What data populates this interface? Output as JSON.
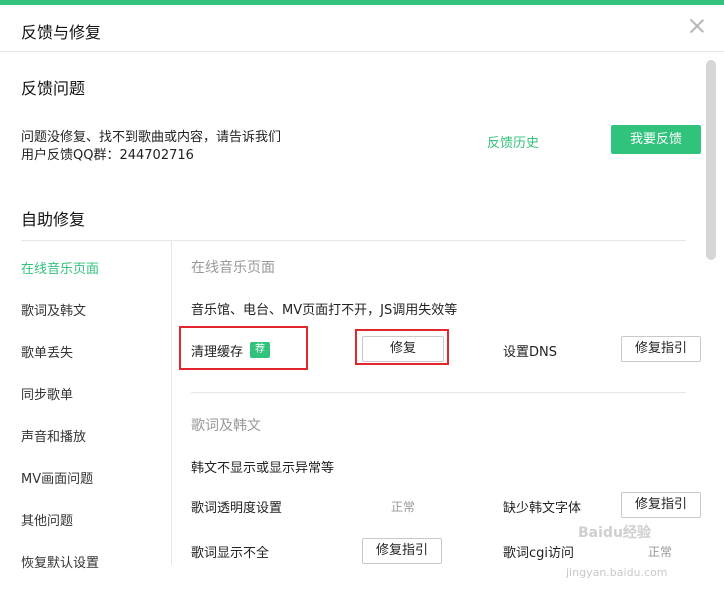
{
  "dialog": {
    "title": "反馈与修复"
  },
  "feedback": {
    "section_title": "反馈问题",
    "line1": "问题没修复、找不到歌曲或内容，请告诉我们",
    "line2": "用户反馈QQ群：244702716",
    "history_link": "反馈历史",
    "submit_button": "我要反馈"
  },
  "selfrepair": {
    "section_title": "自助修复",
    "nav": [
      "在线音乐页面",
      "歌词及韩文",
      "歌单丢失",
      "同步歌单",
      "声音和播放",
      "MV画面问题",
      "其他问题",
      "恢复默认设置"
    ],
    "online": {
      "title": "在线音乐页面",
      "desc": "音乐馆、电台、MV页面打不开，JS调用失效等",
      "clear_cache_label": "清理缓存",
      "recommend_tag": "荐",
      "fix_button": "修复",
      "dns_label": "设置DNS",
      "dns_button": "修复指引"
    },
    "lyrics": {
      "title": "歌词及韩文",
      "desc": "韩文不显示或显示异常等",
      "opacity_label": "歌词透明度设置",
      "opacity_status": "正常",
      "korean_font_label": "缺少韩文字体",
      "korean_font_button": "修复指引",
      "incomplete_label": "歌词显示不全",
      "incomplete_button": "修复指引",
      "cgi_label": "歌词cgi访问",
      "cgi_status": "正常"
    }
  },
  "watermark": {
    "brand": "Baidu经验",
    "url": "jingyan.baidu.com"
  },
  "colors": {
    "accent": "#31c27c",
    "highlight": "#e1272d"
  }
}
